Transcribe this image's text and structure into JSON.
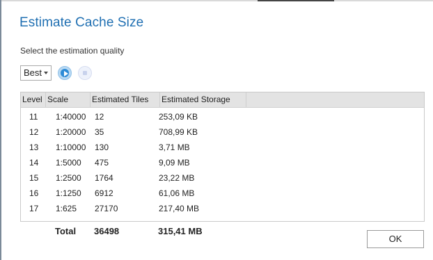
{
  "dialog": {
    "title": "Estimate Cache Size",
    "subtitle": "Select the estimation quality",
    "quality": "Best",
    "ok_label": "OK"
  },
  "table": {
    "headers": [
      "Level",
      "Scale",
      "Estimated Tiles",
      "Estimated Storage"
    ],
    "rows": [
      {
        "level": "11",
        "scale": "1:40000",
        "tiles": "12",
        "storage": "253,09 KB"
      },
      {
        "level": "12",
        "scale": "1:20000",
        "tiles": "35",
        "storage": "708,99 KB"
      },
      {
        "level": "13",
        "scale": "1:10000",
        "tiles": "130",
        "storage": "3,71 MB"
      },
      {
        "level": "14",
        "scale": "1:5000",
        "tiles": "475",
        "storage": "9,09 MB"
      },
      {
        "level": "15",
        "scale": "1:2500",
        "tiles": "1764",
        "storage": "23,22 MB"
      },
      {
        "level": "16",
        "scale": "1:1250",
        "tiles": "6912",
        "storage": "61,06 MB"
      },
      {
        "level": "17",
        "scale": "1:625",
        "tiles": "27170",
        "storage": "217,40 MB"
      }
    ],
    "total": {
      "label": "Total",
      "tiles": "36498",
      "storage": "315,41 MB"
    }
  },
  "icons": {
    "play": "play-circle-icon",
    "stop": "stop-circle-icon",
    "caret": "caret-down-icon"
  },
  "colors": {
    "title": "#1f6fb2",
    "play": "#2d8bd6",
    "header_bg": "#e3e3e3"
  }
}
